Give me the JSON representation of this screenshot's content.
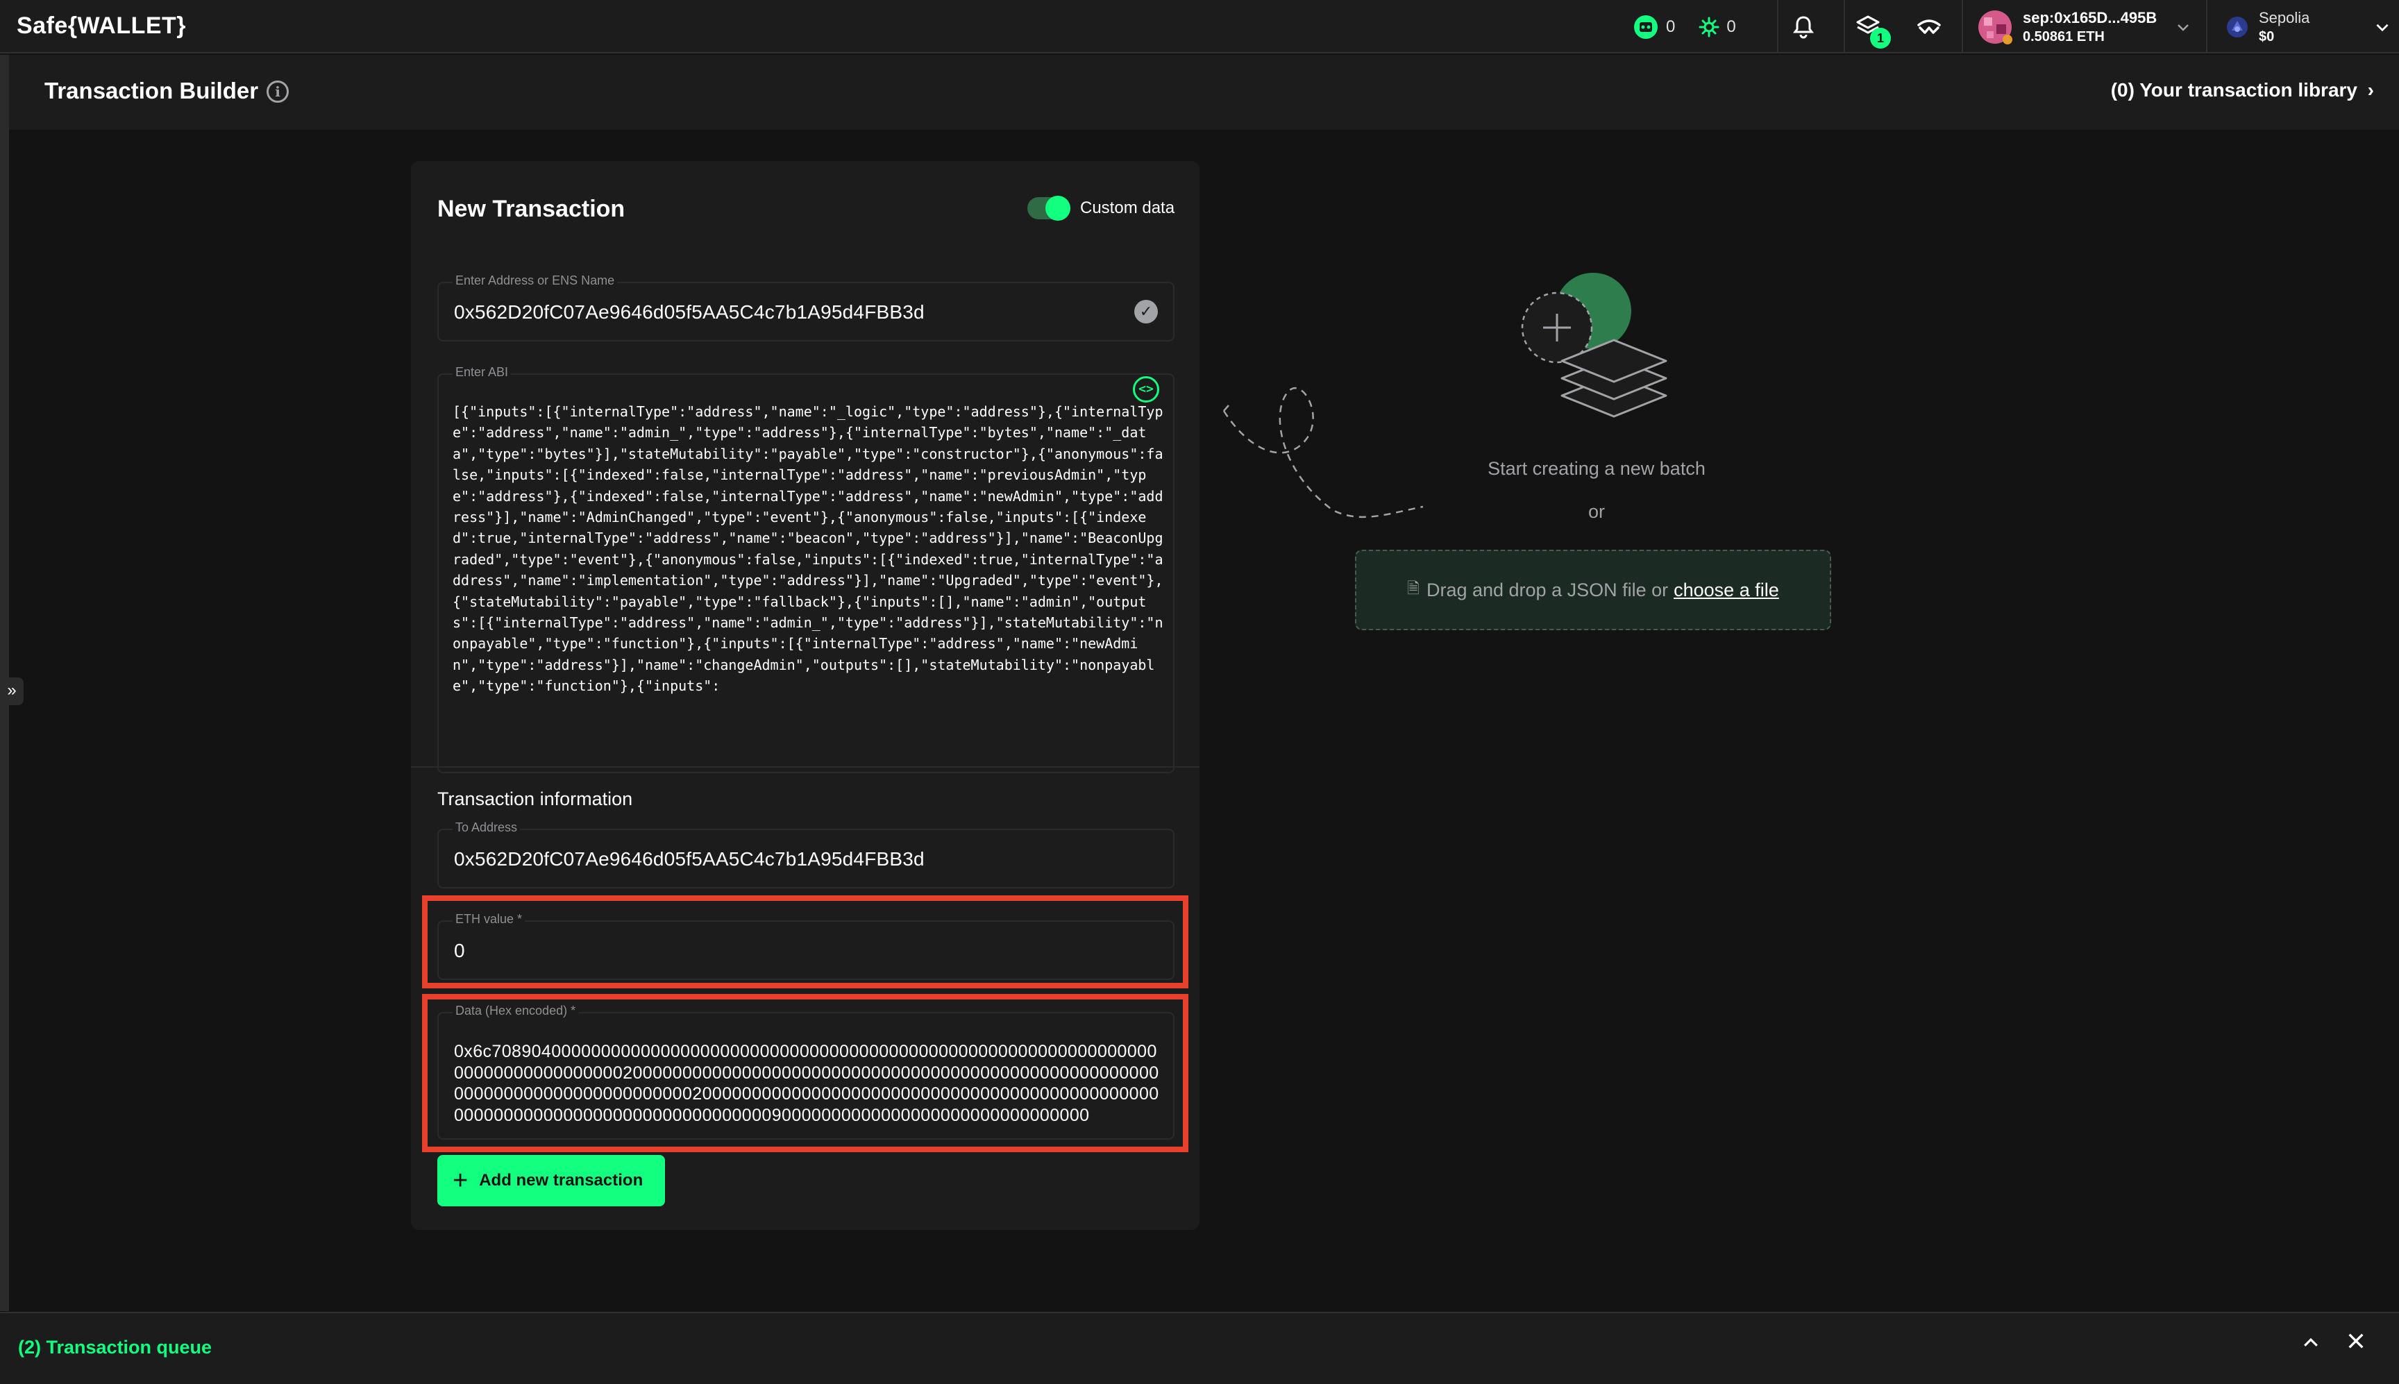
{
  "app": {
    "brand": "Safe{WALLET}"
  },
  "header": {
    "counter_a": "0",
    "counter_b": "0",
    "queue_badge": "1",
    "account_address": "sep:0x165D...495B",
    "account_balance": "0.50861 ETH",
    "network_name": "Sepolia",
    "network_balance": "$0"
  },
  "subheader": {
    "title": "Transaction Builder",
    "library_link": "(0) Your transaction library"
  },
  "card": {
    "title": "New Transaction",
    "toggle_label": "Custom data",
    "toggle_on": true,
    "address_label": "Enter Address or ENS Name",
    "address_value": "0x562D20fC07Ae9646d05f5AA5C4c7b1A95d4FBB3d",
    "abi_label": "Enter ABI",
    "abi_value": "[{\"inputs\":[{\"internalType\":\"address\",\"name\":\"_logic\",\"type\":\"address\"},{\"internalType\":\"address\",\"name\":\"admin_\",\"type\":\"address\"},{\"internalType\":\"bytes\",\"name\":\"_data\",\"type\":\"bytes\"}],\"stateMutability\":\"payable\",\"type\":\"constructor\"},{\"anonymous\":false,\"inputs\":[{\"indexed\":false,\"internalType\":\"address\",\"name\":\"previousAdmin\",\"type\":\"address\"},{\"indexed\":false,\"internalType\":\"address\",\"name\":\"newAdmin\",\"type\":\"address\"}],\"name\":\"AdminChanged\",\"type\":\"event\"},{\"anonymous\":false,\"inputs\":[{\"indexed\":true,\"internalType\":\"address\",\"name\":\"beacon\",\"type\":\"address\"}],\"name\":\"BeaconUpgraded\",\"type\":\"event\"},{\"anonymous\":false,\"inputs\":[{\"indexed\":true,\"internalType\":\"address\",\"name\":\"implementation\",\"type\":\"address\"}],\"name\":\"Upgraded\",\"type\":\"event\"},{\"stateMutability\":\"payable\",\"type\":\"fallback\"},{\"inputs\":[],\"name\":\"admin\",\"outputs\":[{\"internalType\":\"address\",\"name\":\"admin_\",\"type\":\"address\"}],\"stateMutability\":\"nonpayable\",\"type\":\"function\"},{\"inputs\":[{\"internalType\":\"address\",\"name\":\"newAdmin\",\"type\":\"address\"}],\"name\":\"changeAdmin\",\"outputs\":[],\"stateMutability\":\"nonpayable\",\"type\":\"function\"},{\"inputs\":",
    "section_title": "Transaction information",
    "to_label": "To Address",
    "to_value": "0x562D20fC07Ae9646d05f5AA5C4c7b1A95d4FBB3d",
    "eth_label": "ETH value *",
    "eth_value": "0",
    "data_label": "Data (Hex encoded) *",
    "data_value": "0x6c708904000000000000000000000000000000000000000000000000000000000000000000000000000000200000000000000000000000000000000000000000000000000000000000000000000000000000200000000000000000000000000000000000000000000000000000000000000000000000000000090000000000000000000000000000000",
    "add_button": "Add new transaction"
  },
  "empty_state": {
    "text": "Start creating a new batch",
    "or": "or",
    "dropzone_text": "Drag and drop a JSON file or",
    "dropzone_link": "choose a file"
  },
  "queue": {
    "label": "(2) Transaction queue"
  },
  "colors": {
    "accent": "#12ff80",
    "highlight": "#e8402a",
    "background": "#121312",
    "surface": "#1c1c1c"
  }
}
